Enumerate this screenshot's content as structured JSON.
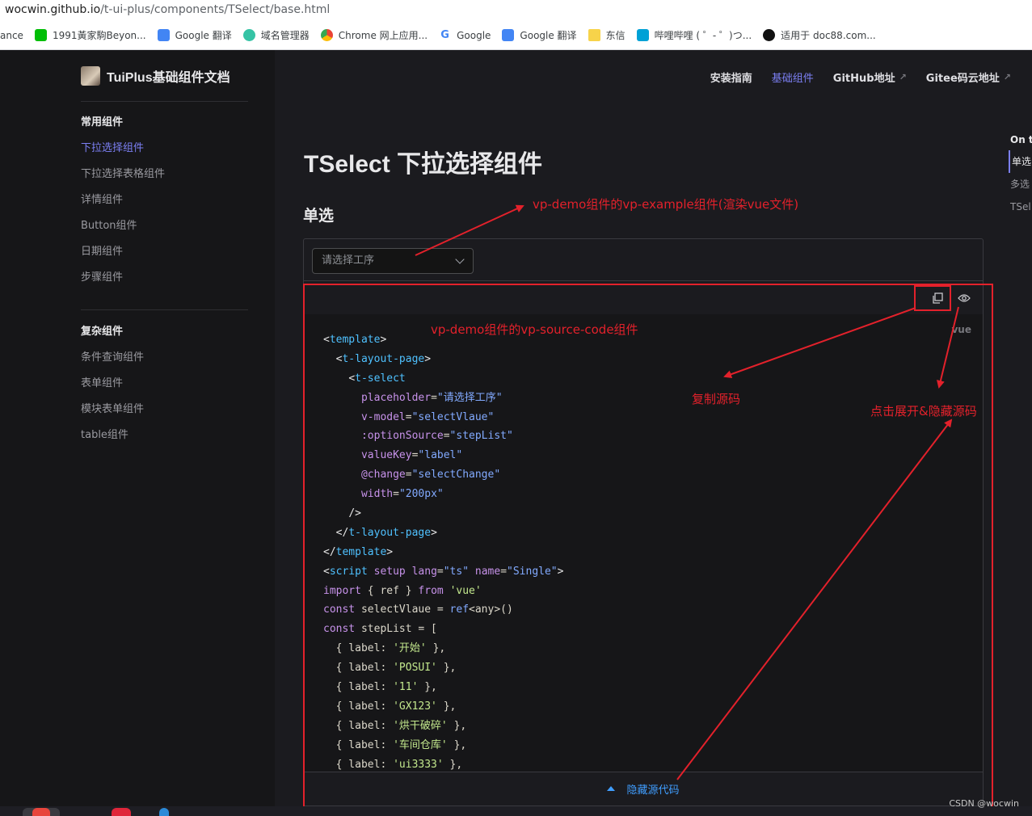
{
  "browser": {
    "url_host": "wocwin.github.io",
    "url_path": "/t-ui-plus/components/TSelect/base.html",
    "bookmarks": [
      {
        "label": "ance",
        "icon": ""
      },
      {
        "label": "1991黃家駒Beyon...",
        "icon": "iqiyi-icon"
      },
      {
        "label": "Google 翻译",
        "icon": "google-translate-icon"
      },
      {
        "label": "域名管理器",
        "icon": "domain-manager-icon"
      },
      {
        "label": "Chrome 网上应用...",
        "icon": "chrome-webstore-icon"
      },
      {
        "label": "Google",
        "icon": "google-icon"
      },
      {
        "label": "Google 翻译",
        "icon": "google-translate-icon"
      },
      {
        "label": "东信",
        "icon": "folder-icon"
      },
      {
        "label": "哔哩哔哩 ( ゜- ゜)つ...",
        "icon": "bilibili-icon"
      },
      {
        "label": "适用于 doc88.com...",
        "icon": "doc88-icon"
      }
    ]
  },
  "brand": {
    "title": "TuiPlus基础组件文档"
  },
  "nav": {
    "items": [
      {
        "label": "安装指南"
      },
      {
        "label": "基础组件"
      },
      {
        "label": "GitHub地址",
        "ext": "↗"
      },
      {
        "label": "Gitee码云地址",
        "ext": "↗"
      }
    ]
  },
  "sidebar": {
    "group1": {
      "title": "常用组件",
      "items": [
        "下拉选择组件",
        "下拉选择表格组件",
        "详情组件",
        "Button组件",
        "日期组件",
        "步骤组件"
      ]
    },
    "group2": {
      "title": "复杂组件",
      "items": [
        "条件查询组件",
        "表单组件",
        "模块表单组件",
        "table组件"
      ]
    }
  },
  "outline": {
    "title": "On t",
    "items": [
      "单选",
      "多选",
      "TSel"
    ]
  },
  "main": {
    "title": "TSelect 下拉选择组件",
    "section": "单选",
    "select_placeholder": "请选择工序",
    "lang": "vue",
    "toggle_label": "隐藏源代码"
  },
  "code": [
    [
      [
        "t-bracket",
        "<"
      ],
      [
        "t-tag",
        "template"
      ],
      [
        "t-bracket",
        ">"
      ]
    ],
    [
      [
        "",
        "  "
      ],
      [
        "t-bracket",
        "<"
      ],
      [
        "t-tag",
        "t-layout-page"
      ],
      [
        "t-bracket",
        ">"
      ]
    ],
    [
      [
        "",
        "    "
      ],
      [
        "t-bracket",
        "<"
      ],
      [
        "t-tag",
        "t-select"
      ]
    ],
    [
      [
        "",
        "      "
      ],
      [
        "t-attr",
        "placeholder"
      ],
      [
        "",
        "="
      ],
      [
        "t-strb",
        "\"请选择工序\""
      ]
    ],
    [
      [
        "",
        "      "
      ],
      [
        "t-attr",
        "v-model"
      ],
      [
        "",
        "="
      ],
      [
        "t-strb",
        "\"selectVlaue\""
      ]
    ],
    [
      [
        "",
        "      "
      ],
      [
        "t-attr",
        ":optionSource"
      ],
      [
        "",
        "="
      ],
      [
        "t-strb",
        "\"stepList\""
      ]
    ],
    [
      [
        "",
        "      "
      ],
      [
        "t-attr",
        "valueKey"
      ],
      [
        "",
        "="
      ],
      [
        "t-strb",
        "\"label\""
      ]
    ],
    [
      [
        "",
        "      "
      ],
      [
        "t-attr",
        "@change"
      ],
      [
        "",
        "="
      ],
      [
        "t-strb",
        "\"selectChange\""
      ]
    ],
    [
      [
        "",
        "      "
      ],
      [
        "t-attr",
        "width"
      ],
      [
        "",
        "="
      ],
      [
        "t-strb",
        "\"200px\""
      ]
    ],
    [
      [
        "",
        "    "
      ],
      [
        "t-bracket",
        "/>"
      ]
    ],
    [
      [
        "",
        "  "
      ],
      [
        "t-bracket",
        "</"
      ],
      [
        "t-tag",
        "t-layout-page"
      ],
      [
        "t-bracket",
        ">"
      ]
    ],
    [
      [
        "t-bracket",
        "</"
      ],
      [
        "t-tag",
        "template"
      ],
      [
        "t-bracket",
        ">"
      ]
    ],
    [
      [
        "t-bracket",
        "<"
      ],
      [
        "t-tag",
        "script"
      ],
      [
        "",
        " "
      ],
      [
        "t-attr",
        "setup"
      ],
      [
        "",
        " "
      ],
      [
        "t-attr",
        "lang"
      ],
      [
        "",
        "="
      ],
      [
        "t-strb",
        "\"ts\""
      ],
      [
        "",
        " "
      ],
      [
        "t-attr",
        "name"
      ],
      [
        "",
        "="
      ],
      [
        "t-strb",
        "\"Single\""
      ],
      [
        "t-bracket",
        ">"
      ]
    ],
    [
      [
        "t-kw",
        "import"
      ],
      [
        "",
        " { ref } "
      ],
      [
        "t-kw",
        "from"
      ],
      [
        "",
        " "
      ],
      [
        "t-str",
        "'vue'"
      ]
    ],
    [
      [
        "t-kw",
        "const"
      ],
      [
        "",
        " selectVlaue = "
      ],
      [
        "t-fn",
        "ref"
      ],
      [
        "",
        "<any>()"
      ]
    ],
    [
      [
        "t-kw",
        "const"
      ],
      [
        "",
        " stepList = ["
      ]
    ],
    [
      [
        "",
        "  { label: "
      ],
      [
        "t-str",
        "'开始'"
      ],
      [
        "",
        " },"
      ]
    ],
    [
      [
        "",
        "  { label: "
      ],
      [
        "t-str",
        "'POSUI'"
      ],
      [
        "",
        " },"
      ]
    ],
    [
      [
        "",
        "  { label: "
      ],
      [
        "t-str",
        "'11'"
      ],
      [
        "",
        " },"
      ]
    ],
    [
      [
        "",
        "  { label: "
      ],
      [
        "t-str",
        "'GX123'"
      ],
      [
        "",
        " },"
      ]
    ],
    [
      [
        "",
        "  { label: "
      ],
      [
        "t-str",
        "'烘干破碎'"
      ],
      [
        "",
        " },"
      ]
    ],
    [
      [
        "",
        "  { label: "
      ],
      [
        "t-str",
        "'车间仓库'"
      ],
      [
        "",
        " },"
      ]
    ],
    [
      [
        "",
        "  { label: "
      ],
      [
        "t-str",
        "'ui3333'"
      ],
      [
        "",
        " },"
      ]
    ]
  ],
  "annotations": {
    "example": "vp-demo组件的vp-example组件(渲染vue文件)",
    "source": "vp-demo组件的vp-source-code组件",
    "copy": "复制源码",
    "toggle": "点击展开&隐藏源码"
  },
  "watermark": "CSDN @wocwin",
  "colors": {
    "accent": "#7b7ff2",
    "annotation": "#e3212b",
    "link": "#409eff"
  }
}
